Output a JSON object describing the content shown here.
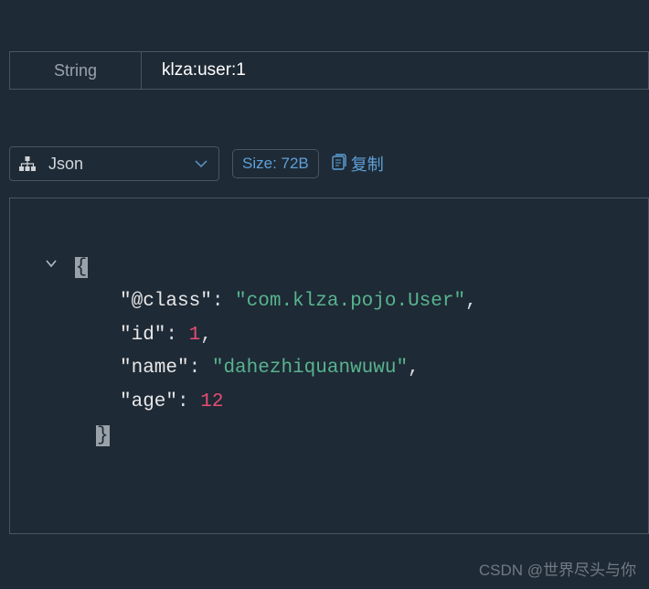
{
  "header": {
    "type_label": "String",
    "key_value": "klza:user:1"
  },
  "toolbar": {
    "view_label": "Json",
    "size_label": "Size: 72B",
    "copy_label": "复制"
  },
  "json": {
    "fields": {
      "class_key": "\"@class\"",
      "class_val": "\"com.klza.pojo.User\"",
      "id_key": "\"id\"",
      "id_val": "1",
      "name_key": "\"name\"",
      "name_val": "\"dahezhiquanwuwu\"",
      "age_key": "\"age\"",
      "age_val": "12"
    },
    "open_brace": "{",
    "close_brace": "}",
    "comma": ",",
    "colon": ": "
  },
  "watermark": "CSDN @世界尽头与你"
}
